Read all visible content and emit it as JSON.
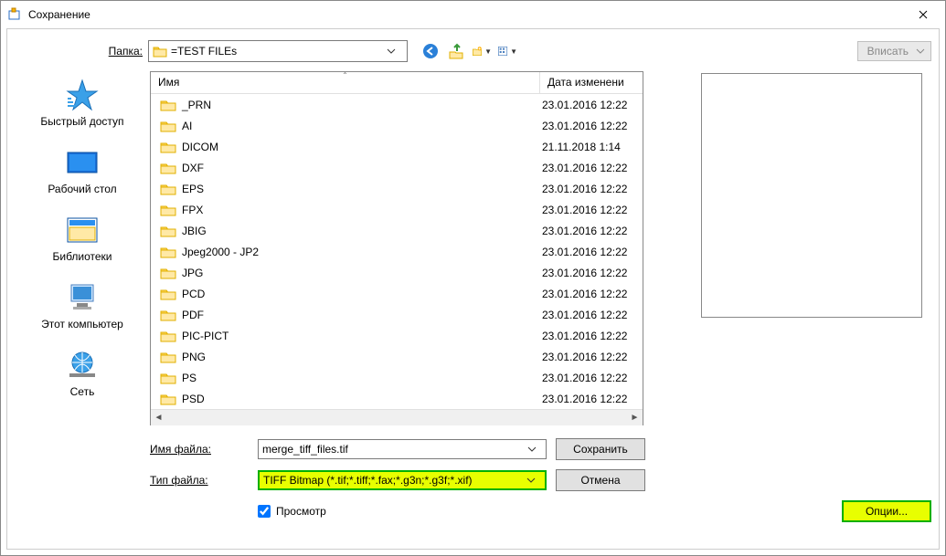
{
  "window": {
    "title": "Сохранение",
    "close_tooltip": "Закрыть"
  },
  "top": {
    "folder_label": "Папка:",
    "folder_name": "=TEST FILEs"
  },
  "fit": {
    "label": "Вписать"
  },
  "sidebar": {
    "items": [
      {
        "label": "Быстрый доступ",
        "icon": "quick-access"
      },
      {
        "label": "Рабочий стол",
        "icon": "desktop"
      },
      {
        "label": "Библиотеки",
        "icon": "libraries"
      },
      {
        "label": "Этот компьютер",
        "icon": "this-pc"
      },
      {
        "label": "Сеть",
        "icon": "network"
      }
    ]
  },
  "columns": {
    "name": "Имя",
    "date": "Дата изменени"
  },
  "files": [
    {
      "name": "_PRN",
      "date": "23.01.2016 12:22"
    },
    {
      "name": "AI",
      "date": "23.01.2016 12:22"
    },
    {
      "name": "DICOM",
      "date": "21.11.2018 1:14"
    },
    {
      "name": "DXF",
      "date": "23.01.2016 12:22"
    },
    {
      "name": "EPS",
      "date": "23.01.2016 12:22"
    },
    {
      "name": "FPX",
      "date": "23.01.2016 12:22"
    },
    {
      "name": "JBIG",
      "date": "23.01.2016 12:22"
    },
    {
      "name": "Jpeg2000 - JP2",
      "date": "23.01.2016 12:22"
    },
    {
      "name": "JPG",
      "date": "23.01.2016 12:22"
    },
    {
      "name": "PCD",
      "date": "23.01.2016 12:22"
    },
    {
      "name": "PDF",
      "date": "23.01.2016 12:22"
    },
    {
      "name": "PIC-PICT",
      "date": "23.01.2016 12:22"
    },
    {
      "name": "PNG",
      "date": "23.01.2016 12:22"
    },
    {
      "name": "PS",
      "date": "23.01.2016 12:22"
    },
    {
      "name": "PSD",
      "date": "23.01.2016 12:22"
    }
  ],
  "filename": {
    "label": "Имя файла:",
    "value": "merge_tiff_files.tif"
  },
  "filetype": {
    "label": "Тип файла:",
    "value": "TIFF Bitmap (*.tif;*.tiff;*.fax;*.g3n;*.g3f;*.xif)"
  },
  "buttons": {
    "save": "Сохранить",
    "cancel": "Отмена",
    "options": "Опции..."
  },
  "preview_chk": {
    "label": "Просмотр",
    "checked": true
  },
  "icons": {
    "back": "back-icon",
    "up": "up-icon",
    "newfolder": "new-folder-icon",
    "views": "views-icon"
  }
}
